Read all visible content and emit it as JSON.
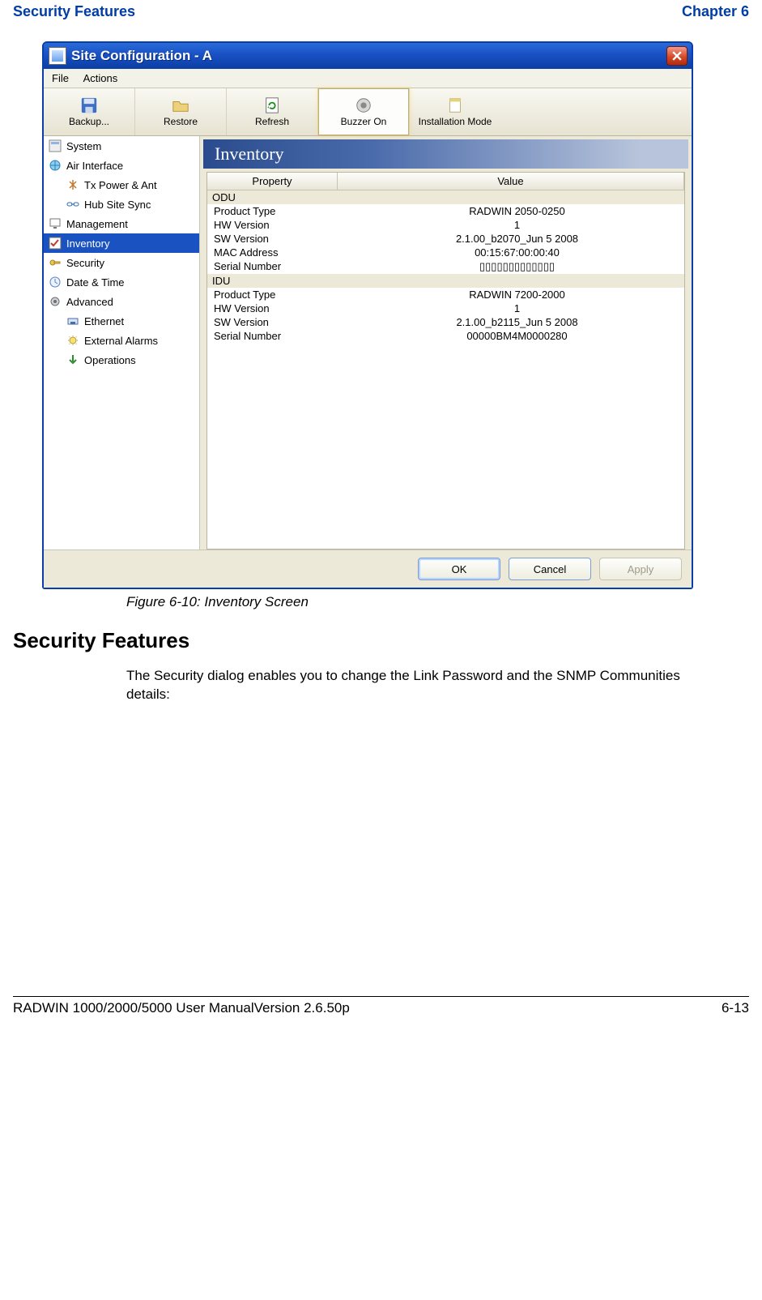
{
  "page_header": {
    "left": "Security Features",
    "right": "Chapter 6"
  },
  "dialog": {
    "title": "Site Configuration - A",
    "menu": {
      "file_label": "File",
      "actions_label": "Actions"
    },
    "toolbar": {
      "backup_label": "Backup...",
      "restore_label": "Restore",
      "refresh_label": "Refresh",
      "buzzer_label": "Buzzer On",
      "install_label": "Installation Mode"
    },
    "sidebar": {
      "items": [
        {
          "label": "System"
        },
        {
          "label": "Air Interface"
        },
        {
          "label": "Tx Power & Ant"
        },
        {
          "label": "Hub Site Sync"
        },
        {
          "label": "Management"
        },
        {
          "label": "Inventory"
        },
        {
          "label": "Security"
        },
        {
          "label": "Date & Time"
        },
        {
          "label": "Advanced"
        },
        {
          "label": "Ethernet"
        },
        {
          "label": "External Alarms"
        },
        {
          "label": "Operations"
        }
      ]
    },
    "panel_title": "Inventory",
    "table": {
      "header_property": "Property",
      "header_value": "Value",
      "section_odu": "ODU",
      "odu_rows": [
        {
          "prop": "Product Type",
          "val": "RADWIN 2050-0250"
        },
        {
          "prop": "HW Version",
          "val": "1"
        },
        {
          "prop": "SW Version",
          "val": "2.1.00_b2070_Jun  5 2008"
        },
        {
          "prop": "MAC Address",
          "val": "00:15:67:00:00:40"
        },
        {
          "prop": "Serial Number",
          "val": "▯▯▯▯▯▯▯▯▯▯▯▯▯"
        }
      ],
      "section_idu": "IDU",
      "idu_rows": [
        {
          "prop": "Product Type",
          "val": "RADWIN 7200-2000"
        },
        {
          "prop": "HW Version",
          "val": "1"
        },
        {
          "prop": "SW Version",
          "val": "2.1.00_b2115_Jun  5 2008"
        },
        {
          "prop": "Serial Number",
          "val": "00000BM4M0000280"
        }
      ]
    },
    "buttons": {
      "ok_label": "OK",
      "cancel_label": "Cancel",
      "apply_label": "Apply"
    }
  },
  "figure_caption": "Figure 6-10: Inventory Screen",
  "section_title": "Security Features",
  "body_text": "The Security dialog enables you to change the Link Password and the SNMP Communities details:",
  "footer": {
    "left": "RADWIN 1000/2000/5000 User ManualVersion  2.6.50p",
    "right": "6-13"
  }
}
